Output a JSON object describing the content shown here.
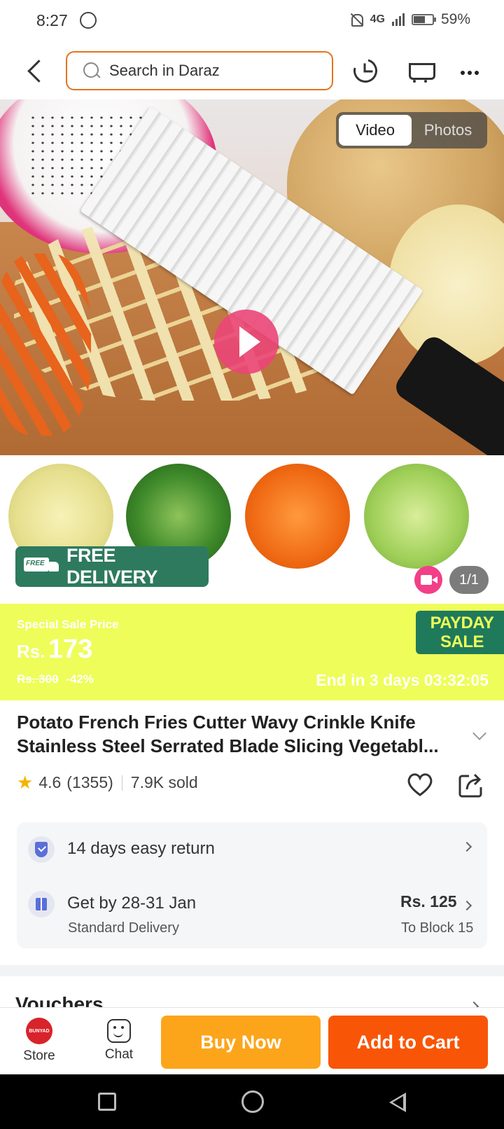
{
  "status_bar": {
    "time": "8:27",
    "network": "4G",
    "battery": "59%",
    "icons": [
      "whatsapp-icon",
      "bell-off-icon",
      "signal-icon",
      "battery-icon"
    ]
  },
  "header": {
    "search_placeholder": "Search in Daraz",
    "icons": [
      "back-icon",
      "search-icon",
      "history-icon",
      "cart-icon",
      "more-icon"
    ]
  },
  "media": {
    "tabs": [
      {
        "label": "Video",
        "active": true
      },
      {
        "label": "Photos",
        "active": false
      }
    ],
    "counter": "1/1",
    "free_delivery": {
      "badge": "FREE",
      "label": "FREE DELIVERY"
    }
  },
  "sale": {
    "label": "Special Sale Price",
    "currency": "Rs.",
    "price": "173",
    "old_price": "Rs. 300",
    "discount": "-42%",
    "badge_line1": "PAYDAY",
    "badge_line2": "SALE",
    "timer": "End in 3 days 03:32:05",
    "colors": {
      "banner": "#eefd5a",
      "badge": "#1f7a5b"
    }
  },
  "product": {
    "title": "Potato French Fries Cutter Wavy Crinkle Knife Stainless Steel Serrated Blade Slicing Vegetabl...",
    "rating": "4.6",
    "reviews": "(1355)",
    "sold": "7.9K sold"
  },
  "delivery": {
    "return_text": "14 days easy return",
    "eta_text": "Get by 28-31 Jan",
    "method": "Standard Delivery",
    "fee": "Rs. 125",
    "destination": "To Block 15"
  },
  "vouchers": {
    "title": "Vouchers"
  },
  "actions": {
    "store_logo": "BUNYAD",
    "store_label": "Store",
    "chat_label": "Chat",
    "buy_now": "Buy Now",
    "add_to_cart": "Add to Cart",
    "colors": {
      "buy_now": "#fca51b",
      "add_to_cart": "#f85606"
    }
  }
}
